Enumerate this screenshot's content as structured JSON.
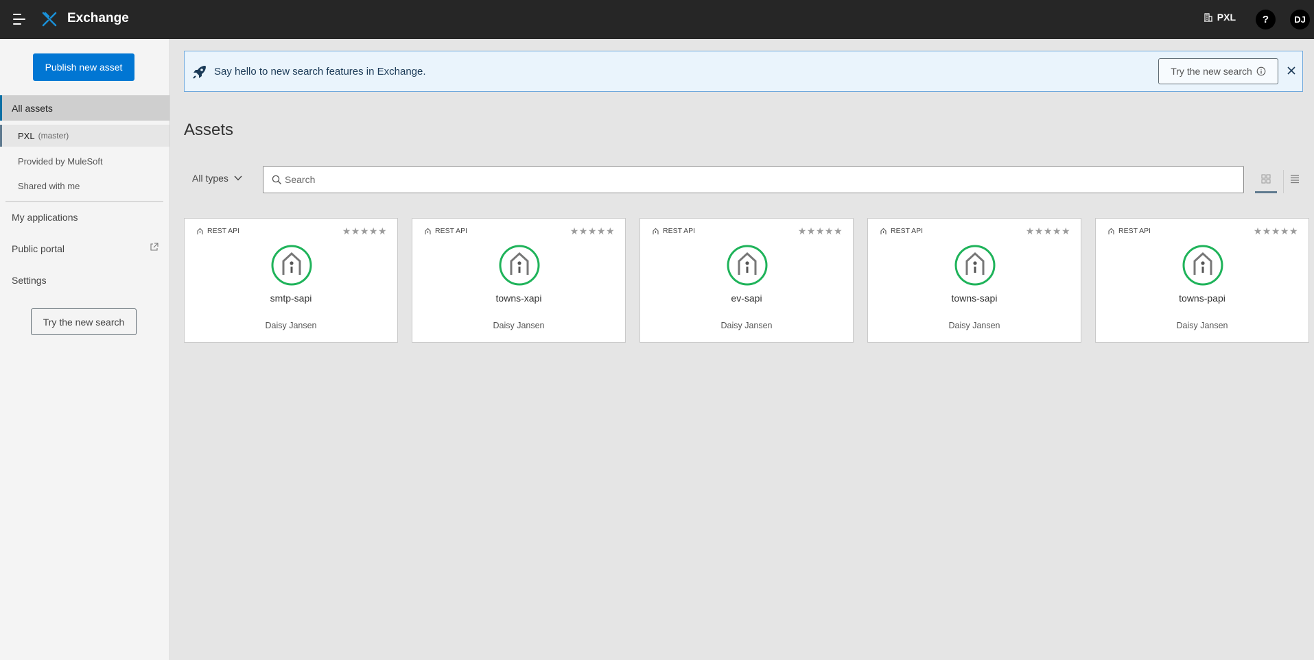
{
  "topbar": {
    "app_title": "Exchange",
    "org_name": "PXL",
    "help_label": "?",
    "avatar_initials": "DJ",
    "logo_color": "#1a8fd6"
  },
  "sidebar": {
    "publish_label": "Publish new asset",
    "all_assets": "All assets",
    "sub_items": [
      {
        "label": "PXL",
        "detail": "(master)",
        "active": true
      },
      {
        "label": "Provided by MuleSoft"
      },
      {
        "label": "Shared with me"
      }
    ],
    "main_items": [
      {
        "label": "My applications"
      },
      {
        "label": "Public portal",
        "external": true
      },
      {
        "label": "Settings"
      }
    ],
    "try_search_label": "Try the new search"
  },
  "banner": {
    "message": "Say hello to new search features in Exchange.",
    "try_label": "Try the new search"
  },
  "main": {
    "title": "Assets",
    "type_filter": "All types",
    "search_placeholder": "Search"
  },
  "assets": [
    {
      "type": "REST API",
      "name": "smtp-sapi",
      "author": "Daisy Jansen",
      "rating": 0,
      "stars": "★★★★★"
    },
    {
      "type": "REST API",
      "name": "towns-xapi",
      "author": "Daisy Jansen",
      "rating": 0,
      "stars": "★★★★★"
    },
    {
      "type": "REST API",
      "name": "ev-sapi",
      "author": "Daisy Jansen",
      "rating": 0,
      "stars": "★★★★★"
    },
    {
      "type": "REST API",
      "name": "towns-sapi",
      "author": "Daisy Jansen",
      "rating": 0,
      "stars": "★★★★★"
    },
    {
      "type": "REST API",
      "name": "towns-papi",
      "author": "Daisy Jansen",
      "rating": 0,
      "stars": "★★★★★"
    }
  ],
  "colors": {
    "primary": "#0176d3",
    "asset_icon_ring": "#1fb35a"
  }
}
